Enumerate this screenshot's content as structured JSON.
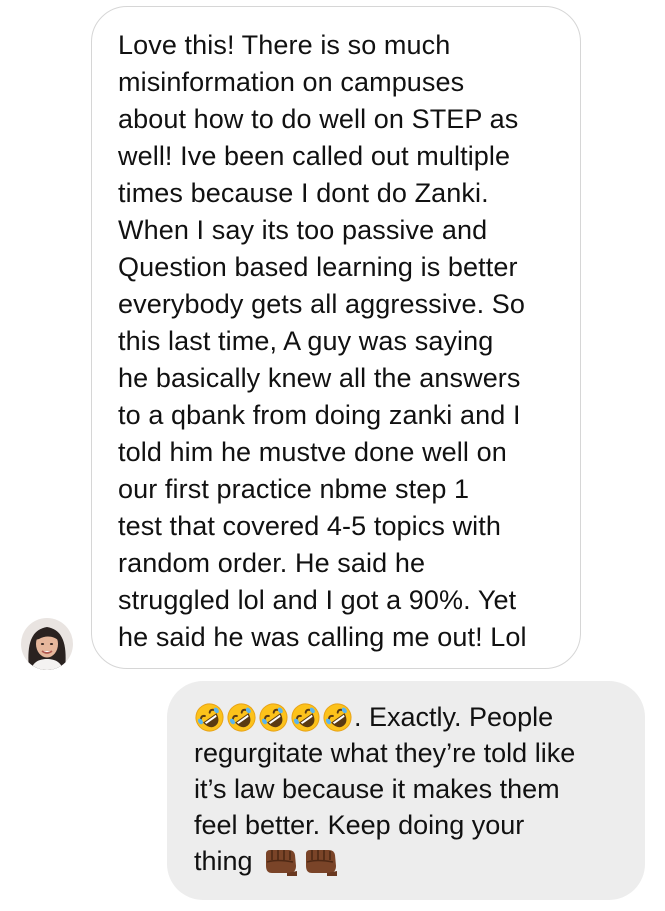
{
  "conversation": {
    "incoming": {
      "sender_avatar_icon": "profile-photo-avatar",
      "lines": [
        "Love this! There is so much",
        "misinformation on campuses",
        "about how to do well on STEP as",
        "well! Ive been called out multiple",
        "times because I dont do Zanki.",
        "When I say its too passive and",
        "Question based learning is better",
        "everybody gets all aggressive. So",
        "this last time, A guy was saying",
        "he basically knew all the answers",
        "to a qbank from doing zanki and I",
        "told him he mustve done well on",
        "our first practice nbme step 1",
        "test that covered 4-5 topics with",
        "random order. He said he",
        "struggled lol and I got a 90%. Yet",
        "he said he was calling me out! Lol"
      ]
    },
    "outgoing": {
      "leading_emoji": [
        "rolling-on-floor-laughing-emoji",
        "rolling-on-floor-laughing-emoji",
        "rolling-on-floor-laughing-emoji",
        "rolling-on-floor-laughing-emoji",
        "rolling-on-floor-laughing-emoji"
      ],
      "line1_text": ". Exactly. People",
      "line2_text": "regurgitate what they’re told like",
      "line3_text": "it’s law because it makes them",
      "line4_text": "feel better.  Keep doing your",
      "line5_text": "thing",
      "trailing_emoji": [
        "fist-bump-emoji",
        "fist-bump-emoji"
      ]
    },
    "colors": {
      "incoming_bubble_bg": "#ffffff",
      "incoming_bubble_border": "#d6d6d6",
      "outgoing_bubble_bg": "#ededed",
      "text": "#111111"
    }
  }
}
